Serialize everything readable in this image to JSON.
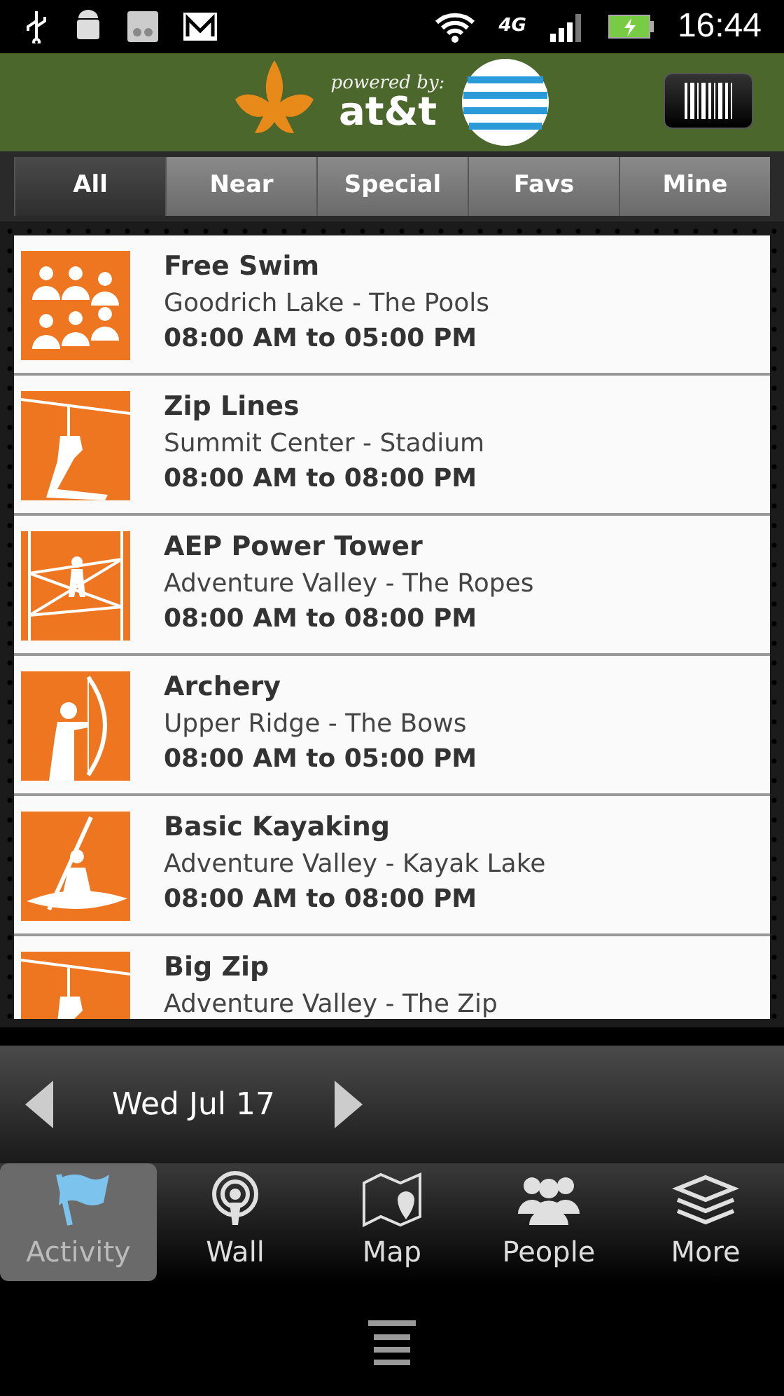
{
  "status_bar": {
    "network": "4G",
    "time": "16:44"
  },
  "header": {
    "tagline": "powered by:",
    "brand": "at&t"
  },
  "tabs": [
    {
      "label": "All",
      "selected": true
    },
    {
      "label": "Near",
      "selected": false
    },
    {
      "label": "Special",
      "selected": false
    },
    {
      "label": "Favs",
      "selected": false
    },
    {
      "label": "Mine",
      "selected": false
    }
  ],
  "activities": [
    {
      "kind": "group",
      "title": "Free Swim",
      "location": "Goodrich Lake - The Pools",
      "hours": "08:00 AM to 05:00 PM"
    },
    {
      "kind": "zipline",
      "title": "Zip Lines",
      "location": "Summit Center - Stadium",
      "hours": "08:00 AM to 08:00 PM"
    },
    {
      "kind": "tower",
      "title": "AEP Power Tower",
      "location": "Adventure Valley - The Ropes",
      "hours": "08:00 AM to 08:00 PM"
    },
    {
      "kind": "archery",
      "title": "Archery",
      "location": "Upper Ridge - The Bows",
      "hours": "08:00 AM to 05:00 PM"
    },
    {
      "kind": "kayak",
      "title": "Basic Kayaking",
      "location": "Adventure Valley - Kayak Lake",
      "hours": "08:00 AM to 08:00 PM"
    },
    {
      "kind": "zipline",
      "title": "Big Zip",
      "location": "Adventure Valley - The Zip"
    }
  ],
  "date_bar": {
    "date": "Wed Jul 17"
  },
  "bottom_nav": [
    {
      "kind": "flag",
      "label": "Activity",
      "selected": true
    },
    {
      "kind": "broadcast",
      "label": "Wall",
      "selected": false
    },
    {
      "kind": "map",
      "label": "Map",
      "selected": false
    },
    {
      "kind": "people",
      "label": "People",
      "selected": false
    },
    {
      "kind": "layers",
      "label": "More",
      "selected": false
    }
  ]
}
